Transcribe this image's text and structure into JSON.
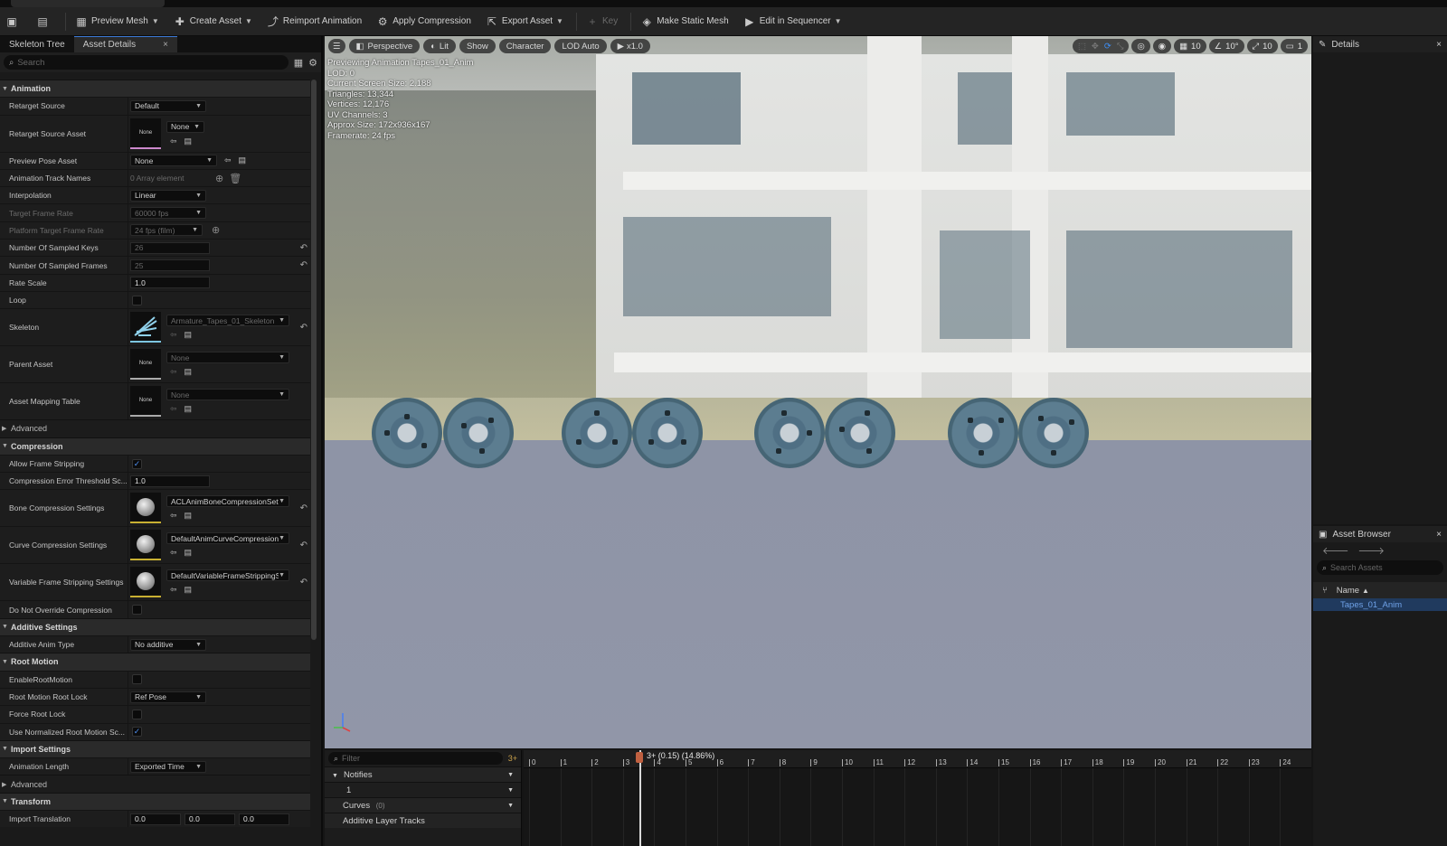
{
  "toolbar": {
    "items": [
      {
        "label": "Preview Mesh",
        "icon": "mesh-icon",
        "dropdown": true
      },
      {
        "label": "Create Asset",
        "icon": "create-asset-icon",
        "dropdown": true
      },
      {
        "label": "Reimport Animation",
        "icon": "reimport-icon",
        "dropdown": false
      },
      {
        "label": "Apply Compression",
        "icon": "compression-icon",
        "dropdown": false
      },
      {
        "label": "Export Asset",
        "icon": "export-icon",
        "dropdown": true
      },
      {
        "label": "Key",
        "icon": "plus-icon",
        "dropdown": false,
        "disabled": true
      },
      {
        "label": "Make Static Mesh",
        "icon": "static-mesh-icon",
        "dropdown": false
      },
      {
        "label": "Edit in Sequencer",
        "icon": "sequencer-icon",
        "dropdown": true
      }
    ]
  },
  "left": {
    "tab_skeleton": "Skeleton Tree",
    "tab_details": "Asset Details",
    "close": "×",
    "search_placeholder": "Search"
  },
  "animation": {
    "title": "Animation",
    "retarget_source": {
      "label": "Retarget Source",
      "value": "Default"
    },
    "retarget_source_asset": {
      "label": "Retarget Source Asset",
      "thumb": "None",
      "value": "None"
    },
    "preview_pose": {
      "label": "Preview Pose Asset",
      "value": "None"
    },
    "track_names": {
      "label": "Animation Track Names",
      "value": "0 Array element"
    },
    "interpolation": {
      "label": "Interpolation",
      "value": "Linear"
    },
    "target_frame_rate": {
      "label": "Target Frame Rate",
      "value": "60000 fps"
    },
    "platform_frame_rate": {
      "label": "Platform Target Frame Rate",
      "value": "24 fps (film)"
    },
    "sampled_keys": {
      "label": "Number Of Sampled Keys",
      "value": "26"
    },
    "sampled_frames": {
      "label": "Number Of Sampled Frames",
      "value": "25"
    },
    "rate_scale": {
      "label": "Rate Scale",
      "value": "1.0"
    },
    "loop": {
      "label": "Loop"
    },
    "skeleton": {
      "label": "Skeleton",
      "value": "Armature_Tapes_01_Skeleton"
    },
    "parent_asset": {
      "label": "Parent Asset",
      "thumb": "None",
      "value": "None"
    },
    "mapping_table": {
      "label": "Asset Mapping Table",
      "thumb": "None",
      "value": "None"
    },
    "advanced": "Advanced"
  },
  "compression": {
    "title": "Compression",
    "allow_stripping": {
      "label": "Allow Frame Stripping"
    },
    "error_threshold": {
      "label": "Compression Error Threshold Sc...",
      "value": "1.0"
    },
    "bone": {
      "label": "Bone Compression Settings",
      "value": "ACLAnimBoneCompressionSetti"
    },
    "curve": {
      "label": "Curve Compression Settings",
      "value": "DefaultAnimCurveCompressionS"
    },
    "variable": {
      "label": "Variable Frame Stripping Settings",
      "value": "DefaultVariableFrameStrippingS"
    },
    "no_override": {
      "label": "Do Not Override Compression"
    }
  },
  "additive": {
    "title": "Additive Settings",
    "type": {
      "label": "Additive Anim Type",
      "value": "No additive"
    }
  },
  "root": {
    "title": "Root Motion",
    "enable": {
      "label": "EnableRootMotion"
    },
    "lock": {
      "label": "Root Motion Root Lock",
      "value": "Ref Pose"
    },
    "force": {
      "label": "Force Root Lock"
    },
    "normalized": {
      "label": "Use Normalized Root Motion Sc..."
    }
  },
  "import": {
    "title": "Import Settings",
    "length": {
      "label": "Animation Length",
      "value": "Exported Time"
    },
    "advanced": "Advanced"
  },
  "transform": {
    "title": "Transform",
    "translation": {
      "label": "Import Translation",
      "x": "0.0",
      "y": "0.0",
      "z": "0.0"
    }
  },
  "viewport": {
    "perspective": "Perspective",
    "lit": "Lit",
    "show": "Show",
    "character": "Character",
    "lod": "LOD Auto",
    "speed": "x1.0",
    "right": {
      "grid": "10",
      "angle": "10°",
      "scale": "10",
      "cam": "1"
    },
    "info": [
      "Previewing Animation Tapes_01_Anim",
      "LOD: 0",
      "Current Screen Size: 2.188",
      "Triangles: 13,344",
      "Vertices: 12,176",
      "UV Channels: 3",
      "Approx Size: 172x936x167",
      "Framerate: 24 fps"
    ]
  },
  "details": {
    "title": "Details"
  },
  "asset_browser": {
    "title": "Asset Browser",
    "search": "Search Assets",
    "col_name": "Name",
    "row": "Tapes_01_Anim"
  },
  "timeline": {
    "filter": "Filter",
    "notifies": "Notifies",
    "track1": "1",
    "curves": "Curves",
    "curves_count": "(0)",
    "additive": "Additive Layer Tracks",
    "playhead": "3+ (0.15) (14.86%)",
    "ticks": [
      "0",
      "1",
      "2",
      "3",
      "4",
      "5",
      "6",
      "7",
      "8",
      "9",
      "10",
      "11",
      "12",
      "13",
      "14",
      "15",
      "16",
      "17",
      "18",
      "19",
      "20",
      "21",
      "22",
      "23",
      "24"
    ]
  },
  "colors": {
    "accent": "#3d7bd9",
    "selection": "#203a5e",
    "playhead": "#c06040"
  }
}
